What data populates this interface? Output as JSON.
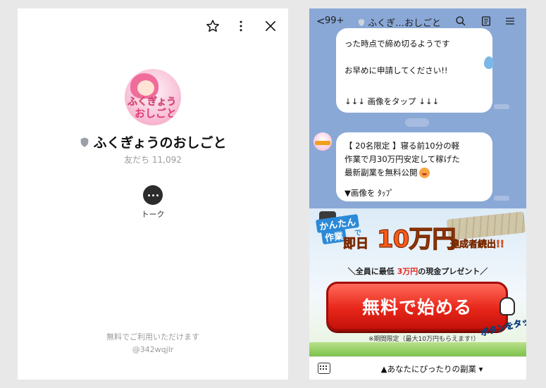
{
  "profile": {
    "name": "ふくぎょうのおしごと",
    "friends_label": "友だち 11,092",
    "talk_label": "トーク",
    "notice": "無料でご利用いただけます",
    "line_id": "@342wqjlr",
    "avatar_logo_line1": "ふくぎょう",
    "avatar_logo_line2": "おしごと"
  },
  "chat": {
    "header": {
      "back_icon": "<",
      "unread_count": "99+",
      "title": "ふくぎ…おしごと"
    },
    "message1": {
      "line1": "った時点で締め切るようです",
      "line2": "お早めに申請してください!!",
      "line3": "↓↓↓ 画像をタップ ↓↓↓"
    },
    "message2": {
      "line1": "【 20名限定 】寝る前10分の軽",
      "line2": "作業で月30万円安定して稼げた",
      "line3": "最新副業を無料公開",
      "line4": "▼画像を ﾀｯﾌﾟ"
    },
    "banner": {
      "kantan": "かんたん",
      "sagyou": "作業",
      "de": "で",
      "sokujitsu": "即日",
      "amount": "10万円",
      "tassei": "達成者続出!!",
      "sub_prefix": "＼全員に最低 ",
      "sub_highlight": "3万円",
      "sub_suffix": "の現金プレゼント／",
      "cta": "無料で始める",
      "tap": "ボタンをタップ",
      "period": "※期間限定（最大10万円もらえます!）"
    },
    "footer": {
      "menu_label": "▲あなたにぴったりの副業 ▾"
    }
  },
  "colors": {
    "chat_bg": "#8aa8d6",
    "cta_red": "#e8261a",
    "accent_orange": "#ff5a1a"
  }
}
